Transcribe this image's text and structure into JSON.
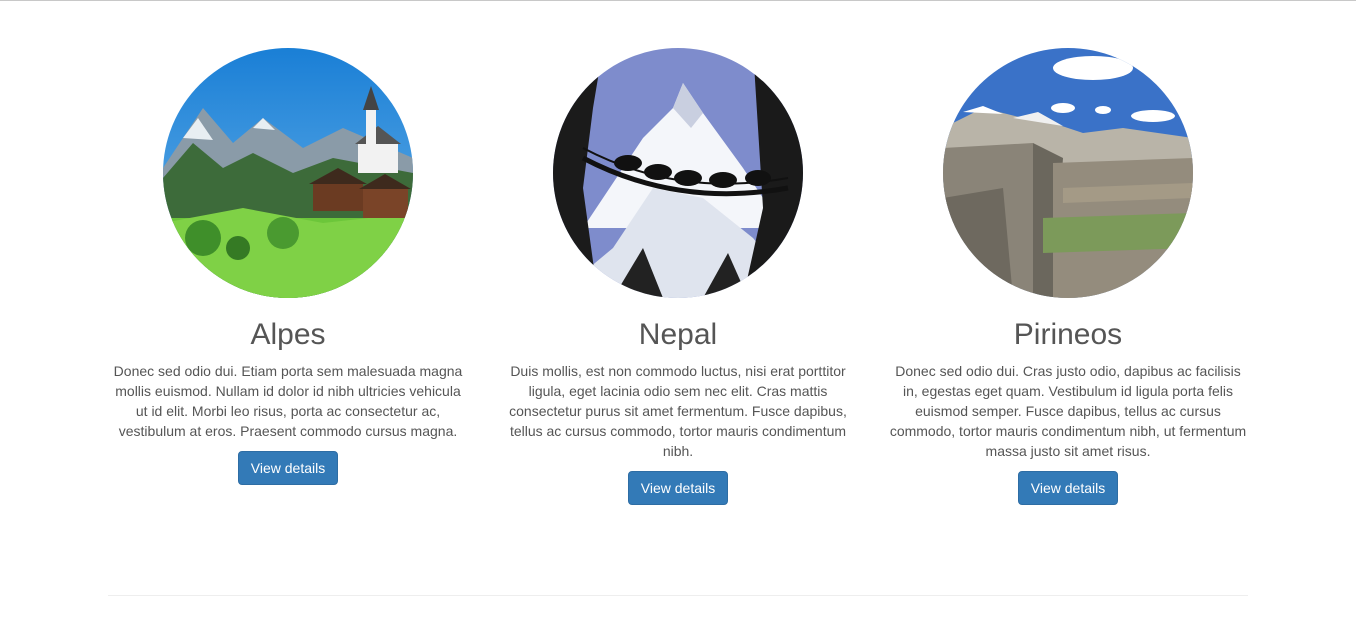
{
  "features": [
    {
      "title": "Alpes",
      "image_icon": "alps-village-landscape",
      "description": "Donec sed odio dui. Etiam porta sem malesuada magna mollis euismod. Nullam id dolor id nibh ultricies vehicula ut id elit. Morbi leo risus, porta ac consectetur ac, vestibulum at eros. Praesent commodo cursus magna.",
      "button_label": "View details"
    },
    {
      "title": "Nepal",
      "image_icon": "nepal-mountain-bridge",
      "description": "Duis mollis, est non commodo luctus, nisi erat porttitor ligula, eget lacinia odio sem nec elit. Cras mattis consectetur purus sit amet fermentum. Fusce dapibus, tellus ac cursus commodo, tortor mauris condimentum nibh.",
      "button_label": "View details"
    },
    {
      "title": "Pirineos",
      "image_icon": "pyrenees-canyon",
      "description": "Donec sed odio dui. Cras justo odio, dapibus ac facilisis in, egestas eget quam. Vestibulum id ligula porta felis euismod semper. Fusce dapibus, tellus ac cursus commodo, tortor mauris condimentum nibh, ut fermentum massa justo sit amet risus.",
      "button_label": "View details"
    }
  ],
  "colors": {
    "button_bg": "#337ab7",
    "button_border": "#2e6da4",
    "text": "#555555"
  }
}
